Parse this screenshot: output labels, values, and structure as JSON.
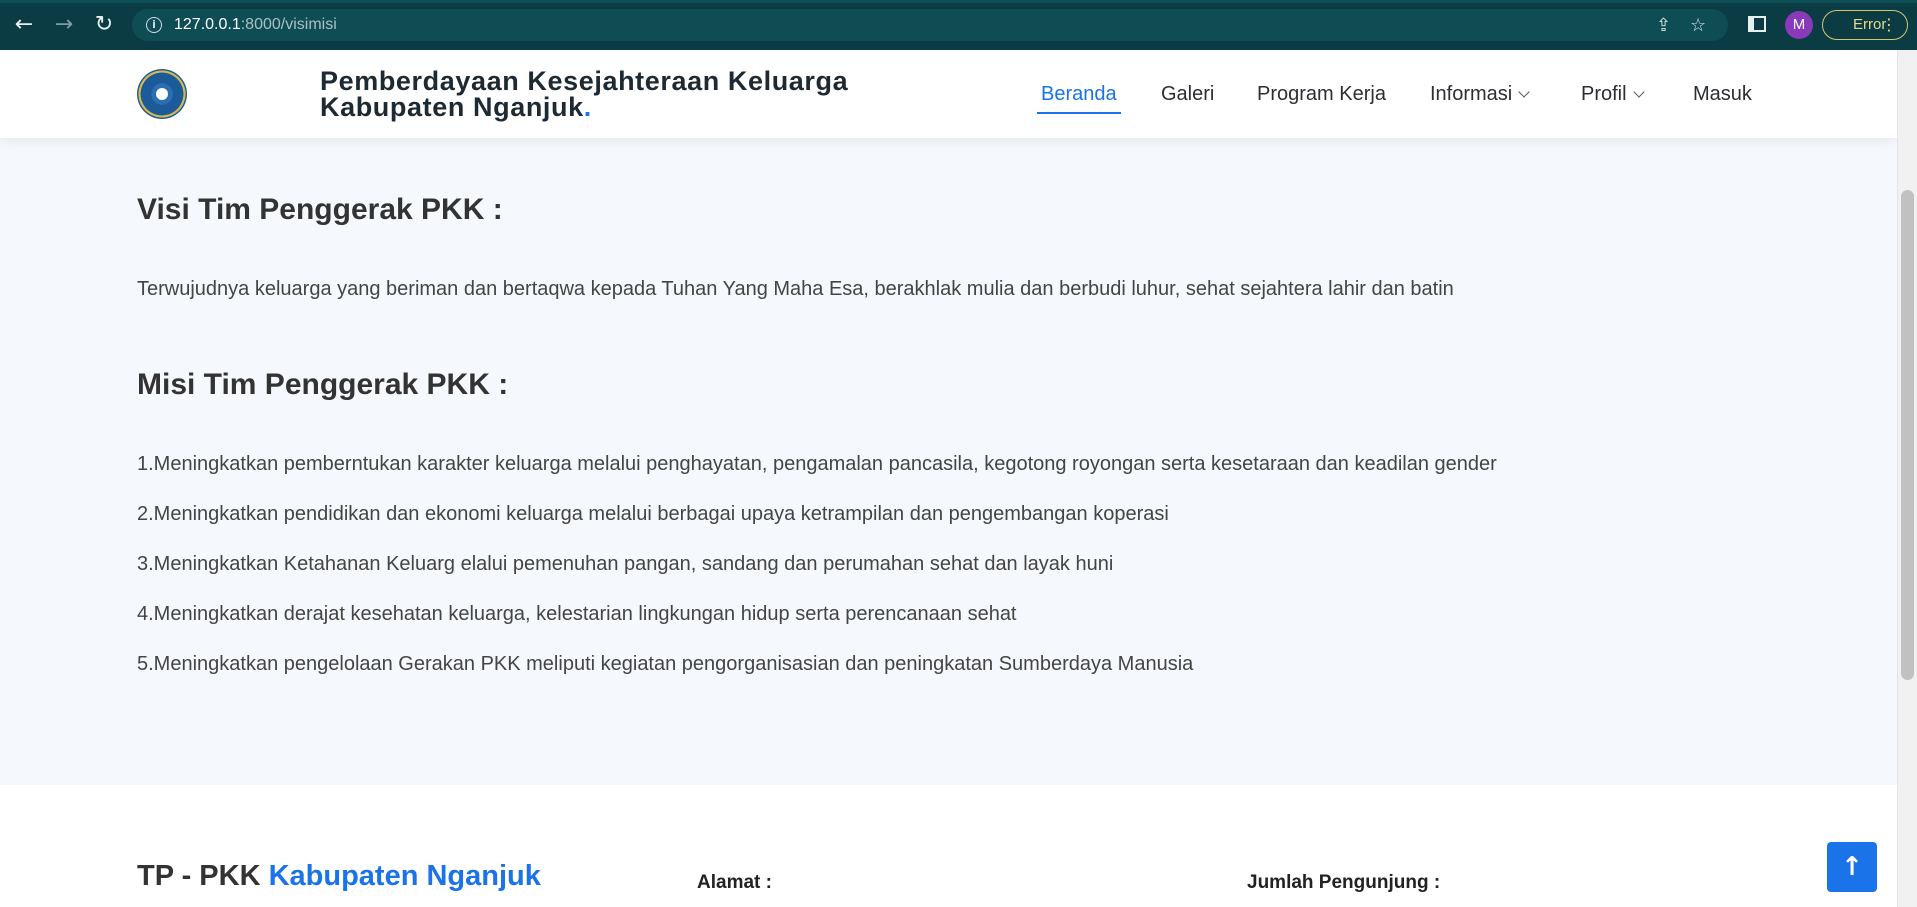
{
  "browser": {
    "url_host": "127.0.0.1",
    "url_path": ":8000/visimisi",
    "profile_initial": "M",
    "error_label": "Error",
    "icons": [
      "back-arrow-icon",
      "forward-arrow-icon",
      "reload-icon",
      "info-icon",
      "share-icon",
      "star-icon",
      "side-panel-icon",
      "more-vert-icon"
    ]
  },
  "header": {
    "title_line1": "Pemberdayaan Kesejahteraan Keluarga",
    "title_line2": "Kabupaten Nganjuk",
    "title_dot": ".",
    "menu": {
      "beranda": "Beranda",
      "galeri": "Galeri",
      "program_kerja": "Program Kerja",
      "informasi": "Informasi",
      "profil": "Profil",
      "masuk": "Masuk"
    },
    "active_menu": "Beranda",
    "accent_color": "#1a73e8"
  },
  "visi": {
    "heading": "Visi Tim Penggerak PKK :",
    "text": "Terwujudnya keluarga yang beriman dan bertaqwa kepada Tuhan Yang Maha Esa, berakhlak mulia dan berbudi luhur, sehat sejahtera lahir dan batin"
  },
  "misi": {
    "heading": "Misi Tim Penggerak PKK :",
    "items": [
      "1.Meningkatkan pemberntukan karakter keluarga melalui penghayatan, pengamalan pancasila, kegotong royongan serta kesetaraan dan keadilan gender",
      "2.Meningkatkan pendidikan dan ekonomi keluarga melalui berbagai upaya ketrampilan dan pengembangan koperasi",
      "3.Meningkatkan Ketahanan Keluarg elalui pemenuhan pangan, sandang dan perumahan sehat dan layak huni",
      "4.Meningkatkan derajat kesehatan keluarga, kelestarian lingkungan hidup serta perencanaan sehat",
      "5.Meningkatkan pengelolaan Gerakan PKK meliputi kegiatan pengorganisasian dan peningkatan Sumberdaya Manusia"
    ]
  },
  "footer": {
    "brand_prefix": "TP - PKK ",
    "brand_accent": "Kabupaten Nganjuk",
    "alamat_label": "Alamat :",
    "pengunjung_label": "Jumlah Pengunjung :"
  }
}
